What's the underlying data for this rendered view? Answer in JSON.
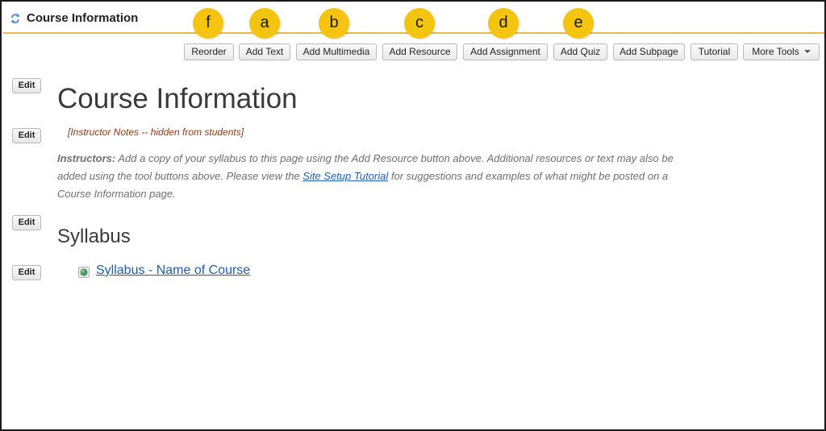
{
  "header": {
    "title": "Course Information"
  },
  "toolbar": {
    "buttons": [
      {
        "label": "Reorder",
        "callout": "f"
      },
      {
        "label": "Add Text",
        "callout": "a"
      },
      {
        "label": "Add Multimedia",
        "callout": "b"
      },
      {
        "label": "Add Resource",
        "callout": "c"
      },
      {
        "label": "Add Assignment",
        "callout": "d"
      },
      {
        "label": "Add Quiz",
        "callout": "e"
      },
      {
        "label": "Add Subpage"
      },
      {
        "label": "Tutorial"
      },
      {
        "label": "More Tools"
      }
    ]
  },
  "content": {
    "edit_label": "Edit",
    "heading": "Course Information",
    "instructor_notes": "[Instructor Notes -- hidden from students]",
    "instructions": {
      "lead": "Instructors:",
      "text_before_link": " Add a copy of your syllabus to this page using the Add Resource button above. Additional resources or text may also be added using the tool buttons above. Please view the ",
      "link": "Site Setup Tutorial",
      "text_after_link": " for suggestions and examples of what might be posted on a Course Information page."
    },
    "section_heading": "Syllabus",
    "resource_link": "Syllabus - Name of Course"
  },
  "colors": {
    "accent": "#e8b84a",
    "callout": "#f5c40f",
    "link": "#1a5fb4",
    "notes": "#8a3a12"
  },
  "icons": {
    "title_icon": "refresh-arrows-icon",
    "resource_icon": "web-resource-icon",
    "more_tools_icon": "caret-down-icon"
  }
}
